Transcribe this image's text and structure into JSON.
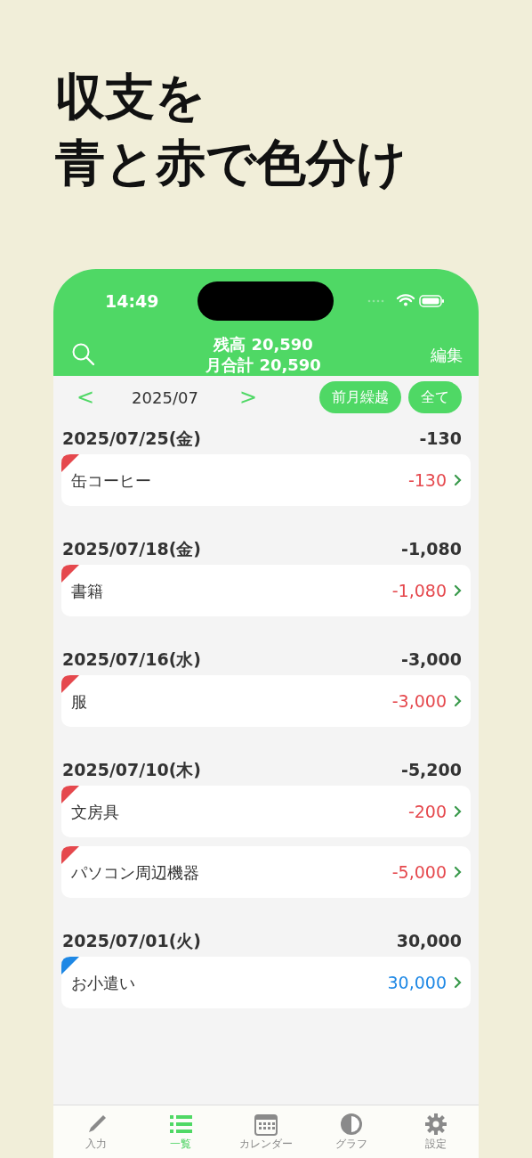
{
  "headline": [
    "収支を",
    "青と赤で色分け"
  ],
  "status_bar": {
    "time": "14:49"
  },
  "nav": {
    "balance": "残高 20,590",
    "month_total": "月合計 20,590",
    "edit": "編集"
  },
  "month_bar": {
    "prev": "<",
    "month": "2025/07",
    "next": ">",
    "buttons": [
      {
        "label": "前月繰越"
      },
      {
        "label": "全て"
      }
    ]
  },
  "days": [
    {
      "date": "2025/07/25(金)",
      "total": "-130",
      "items": [
        {
          "kind": "expense",
          "name": "缶コーヒー",
          "amount": "-130"
        }
      ]
    },
    {
      "date": "2025/07/18(金)",
      "total": "-1,080",
      "items": [
        {
          "kind": "expense",
          "name": "書籍",
          "amount": "-1,080"
        }
      ]
    },
    {
      "date": "2025/07/16(水)",
      "total": "-3,000",
      "items": [
        {
          "kind": "expense",
          "name": "服",
          "amount": "-3,000"
        }
      ]
    },
    {
      "date": "2025/07/10(木)",
      "total": "-5,200",
      "items": [
        {
          "kind": "expense",
          "name": "文房具",
          "amount": "-200"
        },
        {
          "kind": "expense",
          "name": "パソコン周辺機器",
          "amount": "-5,000"
        }
      ]
    },
    {
      "date": "2025/07/01(火)",
      "total": "30,000",
      "items": [
        {
          "kind": "income",
          "name": "お小遣い",
          "amount": "30,000"
        }
      ]
    }
  ],
  "tab_bar": [
    {
      "label": "入力",
      "selected": false
    },
    {
      "label": "一覧",
      "selected": true
    },
    {
      "label": "カレンダー",
      "selected": false
    },
    {
      "label": "グラフ",
      "selected": false
    },
    {
      "label": "設定",
      "selected": false
    }
  ]
}
